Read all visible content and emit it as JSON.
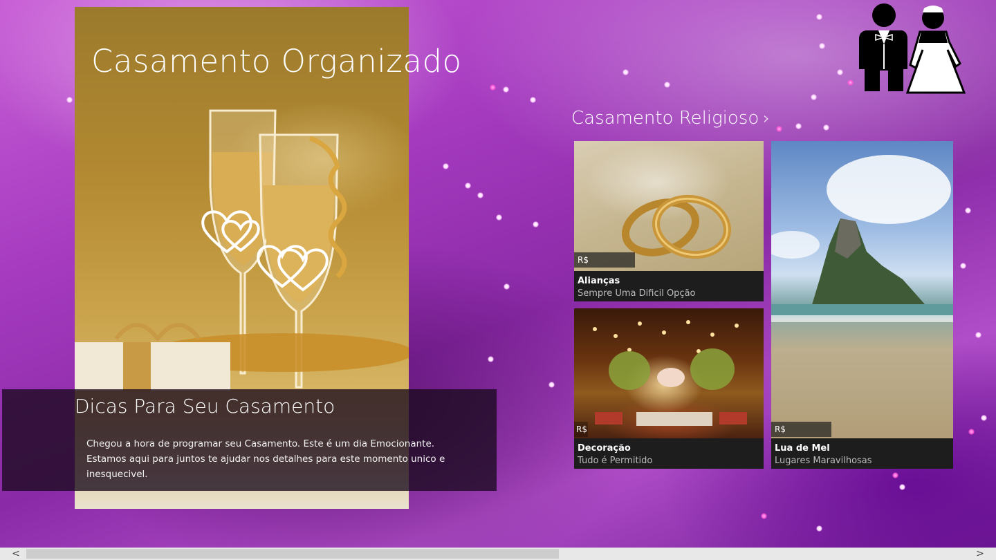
{
  "app": {
    "title": "Casamento Organizado",
    "logo_icon": "bride-and-groom-icon"
  },
  "hero": {
    "image_icon": "champagne-glasses-with-hearts",
    "panel_title": "Dicas Para Seu Casamento",
    "panel_line1": "Chegou a hora de programar seu Casamento. Este é um dia Emocionante.",
    "panel_line2": "Estamos aqui para juntos te ajudar nos detalhes para este momento unico e inesquecivel."
  },
  "section": {
    "title": "Casamento Religioso",
    "chevron": "›"
  },
  "tiles": [
    {
      "price": "R$",
      "title": "Alianças",
      "subtitle": "Sempre Uma Dificil Opção",
      "image_icon": "wedding-rings"
    },
    {
      "price": "R$",
      "title": "Decoração",
      "subtitle": "Tudo é Permitido",
      "image_icon": "decorated-hall"
    },
    {
      "price": "R$",
      "title": "Lua de Mel",
      "subtitle": "Lugares Maravilhosas",
      "image_icon": "island-beach"
    }
  ],
  "scrollbar": {
    "left_arrow": "<",
    "right_arrow": ">"
  },
  "colors": {
    "background": "#a63bc0",
    "tile_caption": "#1d1d1d",
    "hero_gold": "#b48a32"
  }
}
